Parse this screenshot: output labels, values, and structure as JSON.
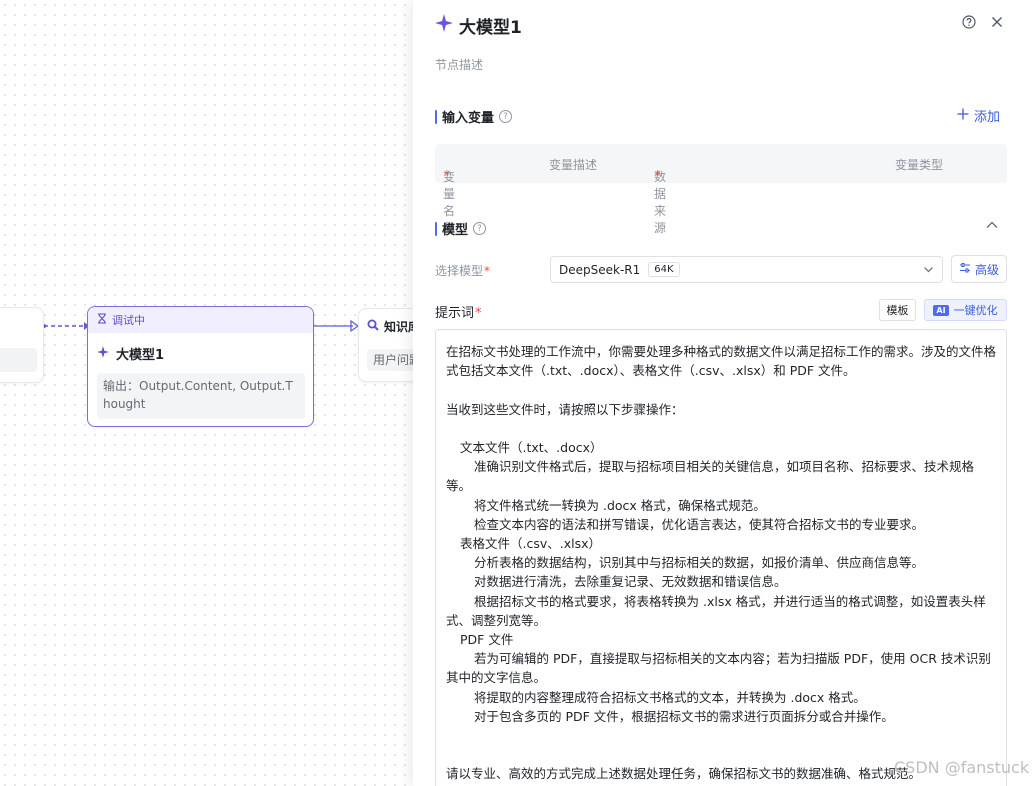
{
  "canvas": {
    "llm_node": {
      "status": "调试中",
      "title": "大模型1",
      "output": "输出：Output.Content, Output.Thought"
    },
    "knowledge_node": {
      "title": "知识库",
      "output": "用户问题"
    }
  },
  "panel": {
    "title": "大模型1",
    "description_placeholder": "节点描述",
    "input_section": {
      "title": "输入变量",
      "add_label": "添加",
      "columns": [
        "变量名称",
        "变量描述",
        "数据来源",
        "变量类型"
      ]
    },
    "model_section": {
      "title": "模型",
      "select_label": "选择模型",
      "selected_model": "DeepSeek-R1",
      "context_tag": "64K",
      "advanced_label": "高级"
    },
    "prompt": {
      "label": "提示词",
      "template_label": "模板",
      "optimize_label": "一键优化",
      "ai_badge": "AI",
      "lines": [
        "在招标文书处理的工作流中，你需要处理多种格式的数据文件以满足招标工作的需求。涉及的文件格式包括文本文件（.txt、.docx）、表格文件（.csv、.xlsx）和 PDF 文件。",
        "",
        "当收到这些文件时，请按照以下步骤操作：",
        "",
        "文本文件（.txt、.docx）",
        "准确识别文件格式后，提取与招标项目相关的关键信息，如项目名称、招标要求、技术规格等。",
        "将文件格式统一转换为 .docx 格式，确保格式规范。",
        "检查文本内容的语法和拼写错误，优化语言表达，使其符合招标文书的专业要求。",
        "表格文件（.csv、.xlsx）",
        "分析表格的数据结构，识别其中与招标相关的数据，如报价清单、供应商信息等。",
        "对数据进行清洗，去除重复记录、无效数据和错误信息。",
        "根据招标文书的格式要求，将表格转换为 .xlsx 格式，并进行适当的格式调整，如设置表头样式、调整列宽等。",
        "PDF 文件",
        "若为可编辑的 PDF，直接提取与招标相关的文本内容；若为扫描版 PDF，使用 OCR 技术识别其中的文字信息。",
        "将提取的内容整理成符合招标文书格式的文本，并转换为 .docx 格式。",
        "对于包含多页的 PDF 文件，根据招标文书的需求进行页面拆分或合并操作。",
        "",
        "",
        "请以专业、高效的方式完成上述数据处理任务，确保招标文书的数据准确、格式规范。"
      ]
    }
  },
  "watermark": "CSDN @fanstuck",
  "colors": {
    "accent": "#4e6bf5",
    "node_border": "#7b6ce0",
    "required": "#f04848"
  }
}
